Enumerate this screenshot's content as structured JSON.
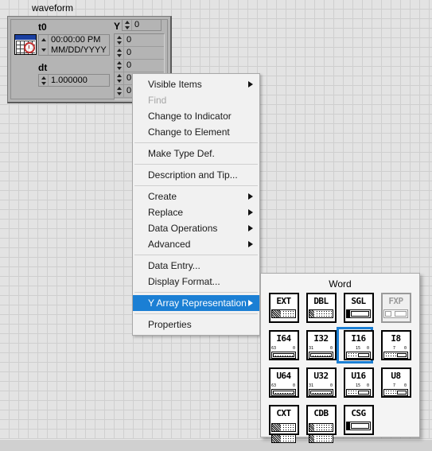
{
  "window": {
    "background_color": "#e3e3e3",
    "grid_color": "#cfcfcf",
    "statusbar_color": "#d0d0d0"
  },
  "waveform_control": {
    "label": "waveform",
    "t0_caption": "t0",
    "t0_time": "00:00:00 PM",
    "t0_date": "MM/DD/YYYY",
    "dt_caption": "dt",
    "dt_value": "1.000000",
    "y_caption": "Y",
    "y_value": "0",
    "y_array_values": [
      "0",
      "0",
      "0",
      "0",
      "0"
    ],
    "calendar_icon": "calendar-clock-icon"
  },
  "context_menu": {
    "items": [
      {
        "label": "Visible Items",
        "submenu": true,
        "disabled": false,
        "selected": false,
        "separator_after": false
      },
      {
        "label": "Find",
        "submenu": false,
        "disabled": true,
        "selected": false,
        "separator_after": false
      },
      {
        "label": "Change to Indicator",
        "submenu": false,
        "disabled": false,
        "selected": false,
        "separator_after": false
      },
      {
        "label": "Change to Element",
        "submenu": false,
        "disabled": false,
        "selected": false,
        "separator_after": true
      },
      {
        "label": "Make Type Def.",
        "submenu": false,
        "disabled": false,
        "selected": false,
        "separator_after": true
      },
      {
        "label": "Description and Tip...",
        "submenu": false,
        "disabled": false,
        "selected": false,
        "separator_after": true
      },
      {
        "label": "Create",
        "submenu": true,
        "disabled": false,
        "selected": false,
        "separator_after": false
      },
      {
        "label": "Replace",
        "submenu": true,
        "disabled": false,
        "selected": false,
        "separator_after": false
      },
      {
        "label": "Data Operations",
        "submenu": true,
        "disabled": false,
        "selected": false,
        "separator_after": false
      },
      {
        "label": "Advanced",
        "submenu": true,
        "disabled": false,
        "selected": false,
        "separator_after": true
      },
      {
        "label": "Data Entry...",
        "submenu": false,
        "disabled": false,
        "selected": false,
        "separator_after": false
      },
      {
        "label": "Display Format...",
        "submenu": false,
        "disabled": false,
        "selected": false,
        "separator_after": true
      },
      {
        "label": "Y Array Representation",
        "submenu": true,
        "disabled": false,
        "selected": true,
        "separator_after": true
      },
      {
        "label": "Properties",
        "submenu": false,
        "disabled": false,
        "selected": false,
        "separator_after": false
      }
    ],
    "highlight_color": "#1b7fd4"
  },
  "representation_palette": {
    "title": "Word",
    "selected": "I16",
    "selection_color": "#1b7fd4",
    "rows": [
      [
        {
          "label": "EXT",
          "kind": "float",
          "disabled": false,
          "selected": false
        },
        {
          "label": "DBL",
          "kind": "float",
          "disabled": false,
          "selected": false
        },
        {
          "label": "SGL",
          "kind": "float",
          "disabled": false,
          "selected": false
        },
        {
          "label": "FXP",
          "kind": "fixed",
          "disabled": true,
          "selected": false
        }
      ],
      [
        {
          "label": "I64",
          "kind": "int",
          "disabled": false,
          "selected": false,
          "hi_bit": "63",
          "lo_bit": "0"
        },
        {
          "label": "I32",
          "kind": "int",
          "disabled": false,
          "selected": false,
          "hi_bit": "31",
          "lo_bit": "0"
        },
        {
          "label": "I16",
          "kind": "int",
          "disabled": false,
          "selected": true,
          "hi_bit": "15",
          "lo_bit": "0"
        },
        {
          "label": "I8",
          "kind": "int",
          "disabled": false,
          "selected": false,
          "hi_bit": "7",
          "lo_bit": "0"
        }
      ],
      [
        {
          "label": "U64",
          "kind": "uint",
          "disabled": false,
          "selected": false,
          "hi_bit": "63",
          "lo_bit": "0"
        },
        {
          "label": "U32",
          "kind": "uint",
          "disabled": false,
          "selected": false,
          "hi_bit": "31",
          "lo_bit": "0"
        },
        {
          "label": "U16",
          "kind": "uint",
          "disabled": false,
          "selected": false,
          "hi_bit": "15",
          "lo_bit": "0"
        },
        {
          "label": "U8",
          "kind": "uint",
          "disabled": false,
          "selected": false,
          "hi_bit": "7",
          "lo_bit": "0"
        }
      ],
      [
        {
          "label": "CXT",
          "kind": "complex",
          "disabled": false,
          "selected": false
        },
        {
          "label": "CDB",
          "kind": "complex",
          "disabled": false,
          "selected": false
        },
        {
          "label": "CSG",
          "kind": "complex",
          "disabled": false,
          "selected": false
        }
      ]
    ]
  }
}
